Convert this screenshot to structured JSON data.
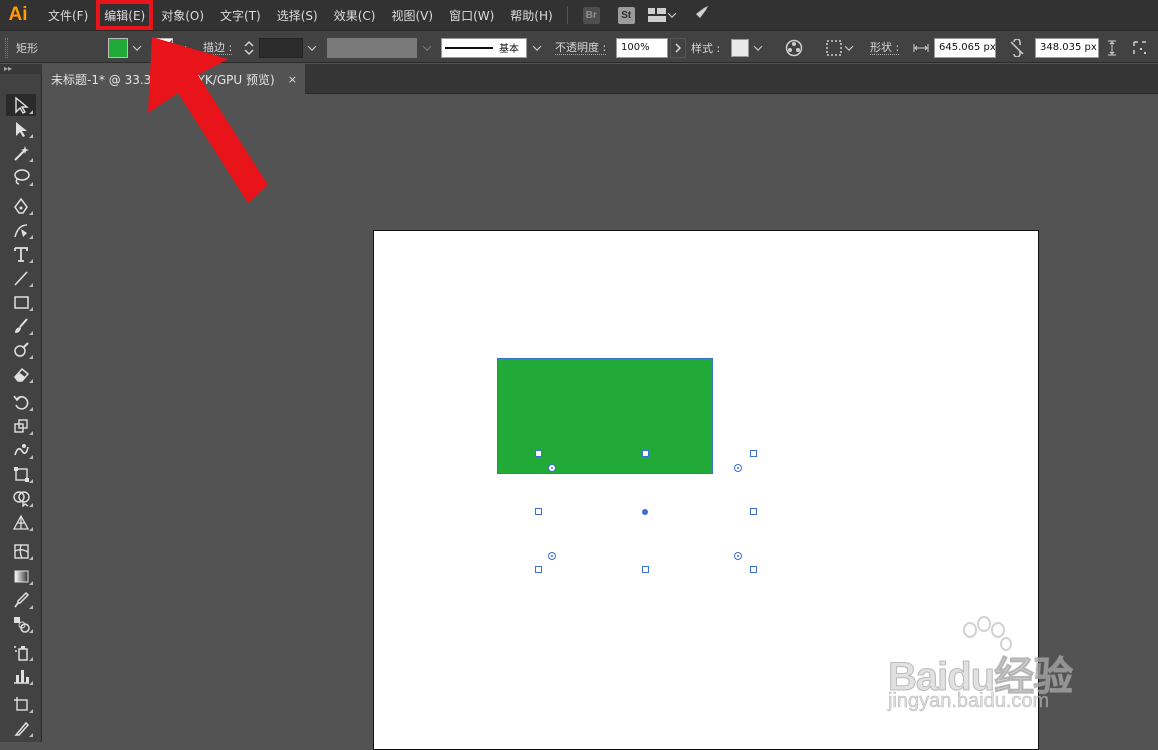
{
  "app": {
    "logo": "Ai"
  },
  "menu": {
    "items": [
      "文件(F)",
      "编辑(E)",
      "对象(O)",
      "文字(T)",
      "选择(S)",
      "效果(C)",
      "视图(V)",
      "窗口(W)",
      "帮助(H)"
    ],
    "highlighted": "编辑(E)",
    "bridge_badge": "Br",
    "stock_badge": "St"
  },
  "control_bar": {
    "object_type": "矩形",
    "fill_color": "#22aa38",
    "stroke_label": "描边 :",
    "stroke_style_label": "基本",
    "opacity_label": "不透明度 :",
    "opacity_value": "100%",
    "style_label": "样式 :",
    "shape_label": "形状 :",
    "width_value": "645.065 px",
    "height_value": "348.035 px"
  },
  "document": {
    "tab_title": "未标题-1* @ 33.33% (CMYK/GPU 预览)",
    "close_glyph": "×"
  },
  "canvas": {
    "artboard_color": "#ffffff",
    "rect_fill": "#22aa38",
    "selection_color": "#3b6fd6"
  },
  "annotation": {
    "color": "#e8141a"
  },
  "watermark": {
    "brand": "Baidu经验",
    "url": "jingyan.baidu.com"
  }
}
